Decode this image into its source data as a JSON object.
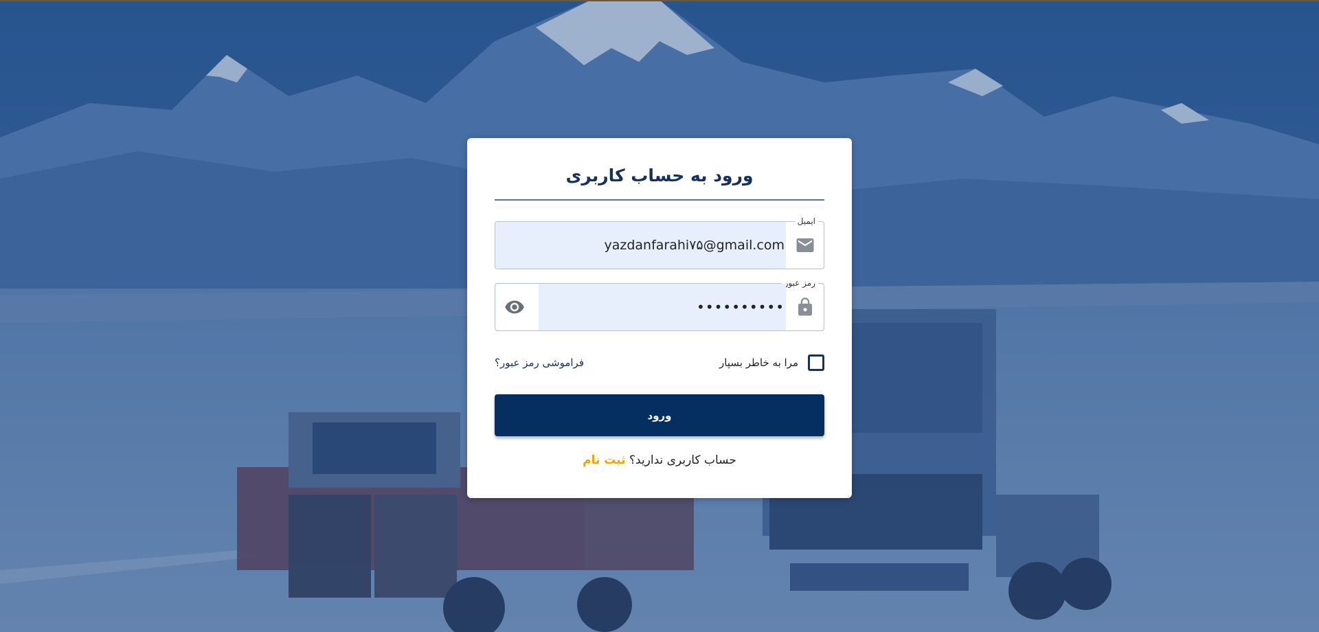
{
  "login": {
    "title": "ورود به حساب کاربری",
    "email_label": "ایمیل",
    "email_value": "yazdanfarahi۷۵@gmail.com",
    "password_label": "رمز عبور",
    "password_value": "••••••••••",
    "remember_label": "مرا به خاطر بسپار",
    "remember_checked": false,
    "forgot_label": "فراموشی رمز عبور؟",
    "submit_label": "ورود",
    "signup_question": "حساب کاربری ندارید؟",
    "signup_link": "ثبت نام"
  },
  "icons": {
    "email": "mail-icon",
    "password": "lock-icon",
    "toggle": "eye-icon"
  },
  "colors": {
    "primary": "#052f61",
    "title": "#15315e",
    "accent": "#f5a300",
    "field_fill": "#e8effc"
  }
}
